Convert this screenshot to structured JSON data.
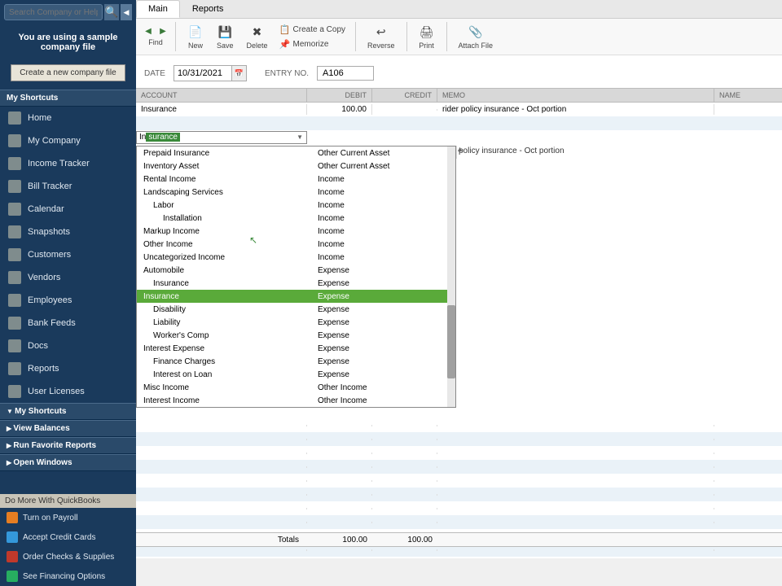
{
  "sidebar": {
    "search_placeholder": "Search Company or Help",
    "sample_msg": "You are using a sample company file",
    "create_file": "Create a new company file",
    "shortcuts_header": "My Shortcuts",
    "nav": [
      {
        "label": "Home"
      },
      {
        "label": "My Company"
      },
      {
        "label": "Income Tracker"
      },
      {
        "label": "Bill Tracker"
      },
      {
        "label": "Calendar"
      },
      {
        "label": "Snapshots"
      },
      {
        "label": "Customers"
      },
      {
        "label": "Vendors"
      },
      {
        "label": "Employees"
      },
      {
        "label": "Bank Feeds"
      },
      {
        "label": "Docs"
      },
      {
        "label": "Reports"
      },
      {
        "label": "User Licenses"
      }
    ],
    "collapsibles": [
      "My Shortcuts",
      "View Balances",
      "Run Favorite Reports",
      "Open Windows"
    ],
    "do_more": "Do More With QuickBooks",
    "bottom": [
      {
        "label": "Turn on Payroll",
        "color": "#e67e22"
      },
      {
        "label": "Accept Credit Cards",
        "color": "#3498db"
      },
      {
        "label": "Order Checks & Supplies",
        "color": "#c0392b"
      },
      {
        "label": "See Financing Options",
        "color": "#27ae60"
      }
    ]
  },
  "tabs": {
    "main": "Main",
    "reports": "Reports"
  },
  "toolbar": {
    "find": "Find",
    "new": "New",
    "save": "Save",
    "delete": "Delete",
    "create_copy": "Create a Copy",
    "memorize": "Memorize",
    "reverse": "Reverse",
    "print": "Print",
    "attach": "Attach File"
  },
  "entry": {
    "date_label": "DATE",
    "date_value": "10/31/2021",
    "entry_label": "ENTRY NO.",
    "entry_value": "A106"
  },
  "grid": {
    "headers": {
      "account": "ACCOUNT",
      "debit": "DEBIT",
      "credit": "CREDIT",
      "memo": "MEMO",
      "name": "NAME"
    },
    "row1": {
      "account": "Insurance",
      "debit": "100.00",
      "credit": "",
      "memo": "rider policy insurance - Oct portion"
    },
    "row2": {
      "input_prefix": "In",
      "input_sel": "surance",
      "memo_partial": "policy insurance - Oct portion"
    }
  },
  "dropdown": [
    {
      "name": "Prepaid Insurance",
      "type": "Other Current Asset",
      "indent": 0
    },
    {
      "name": "Inventory Asset",
      "type": "Other Current Asset",
      "indent": 0
    },
    {
      "name": "Rental Income",
      "type": "Income",
      "indent": 0
    },
    {
      "name": "Landscaping Services",
      "type": "Income",
      "indent": 0
    },
    {
      "name": "Labor",
      "type": "Income",
      "indent": 1
    },
    {
      "name": "Installation",
      "type": "Income",
      "indent": 2
    },
    {
      "name": "Markup Income",
      "type": "Income",
      "indent": 0
    },
    {
      "name": "Other Income",
      "type": "Income",
      "indent": 0
    },
    {
      "name": "Uncategorized Income",
      "type": "Income",
      "indent": 0
    },
    {
      "name": "Automobile",
      "type": "Expense",
      "indent": 0
    },
    {
      "name": "Insurance",
      "type": "Expense",
      "indent": 1
    },
    {
      "name": "Insurance",
      "type": "Expense",
      "indent": 0,
      "selected": true
    },
    {
      "name": "Disability",
      "type": "Expense",
      "indent": 1
    },
    {
      "name": "Liability",
      "type": "Expense",
      "indent": 1
    },
    {
      "name": "Worker's Comp",
      "type": "Expense",
      "indent": 1
    },
    {
      "name": "Interest Expense",
      "type": "Expense",
      "indent": 0
    },
    {
      "name": "Finance Charges",
      "type": "Expense",
      "indent": 1
    },
    {
      "name": "Interest on Loan",
      "type": "Expense",
      "indent": 1
    },
    {
      "name": "Misc Income",
      "type": "Other Income",
      "indent": 0
    },
    {
      "name": "Interest Income",
      "type": "Other Income",
      "indent": 0
    }
  ],
  "totals": {
    "label": "Totals",
    "debit": "100.00",
    "credit": "100.00"
  }
}
